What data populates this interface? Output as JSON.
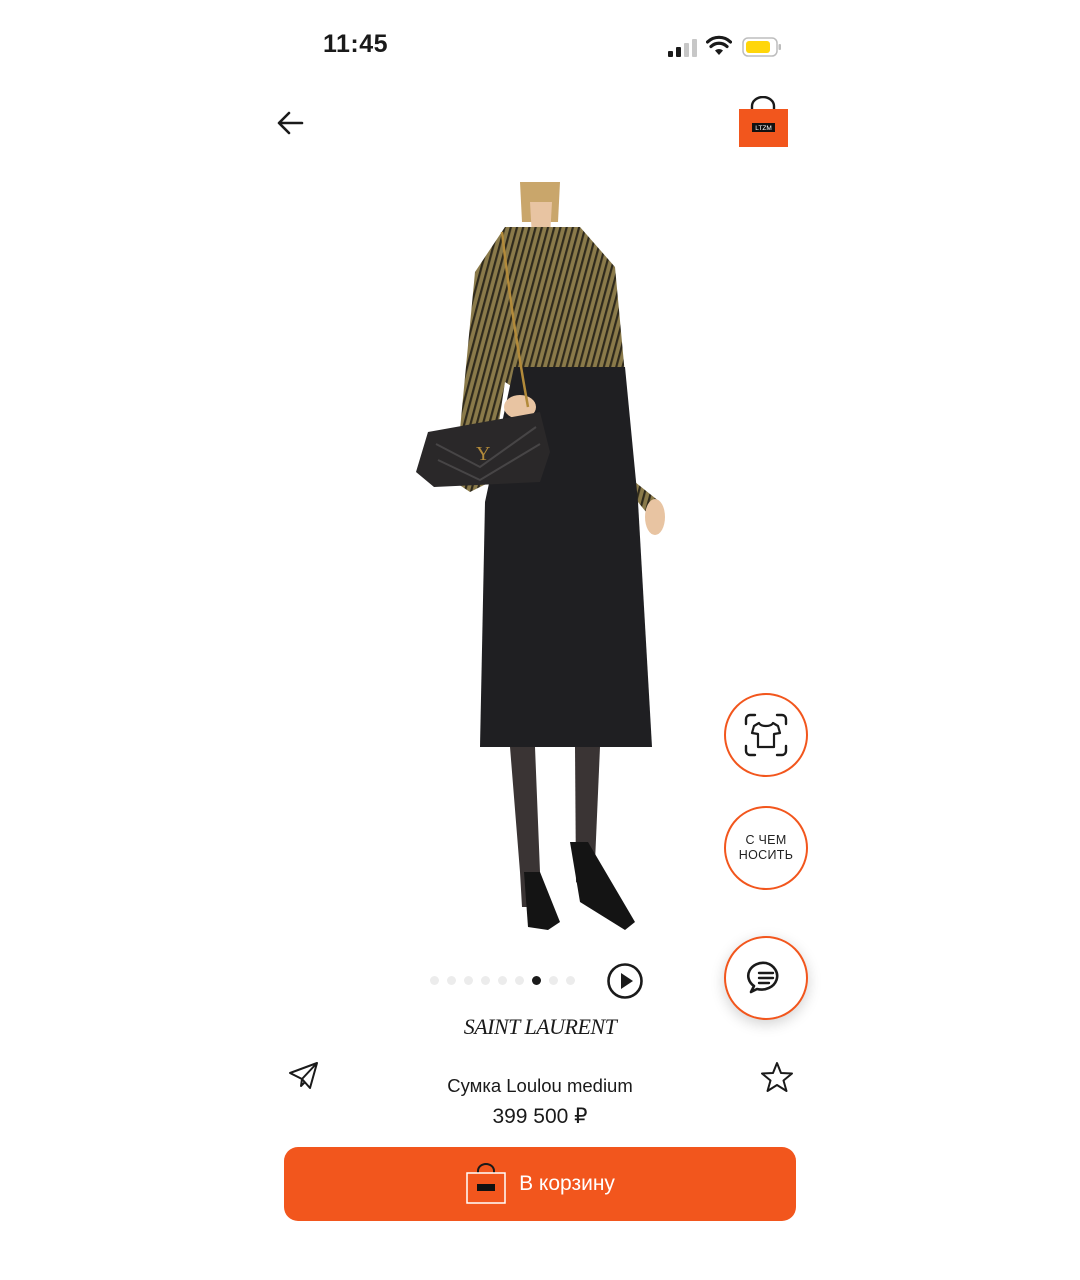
{
  "status_bar": {
    "time": "11:45"
  },
  "header": {
    "back_icon": "arrow-left-icon",
    "bag_icon": "shopping-bag-icon",
    "bag_logo_text": "LTZM"
  },
  "gallery": {
    "dot_count": 9,
    "active_dot_index": 6
  },
  "floating": {
    "wear_label": "С ЧЕМ\nНОСИТЬ"
  },
  "product": {
    "brand": "SAINT LAURENT",
    "name": "Сумка Loulou medium",
    "price": "399 500 ₽"
  },
  "cart_button": {
    "label": "В корзину"
  },
  "colors": {
    "accent": "#f2561d"
  }
}
